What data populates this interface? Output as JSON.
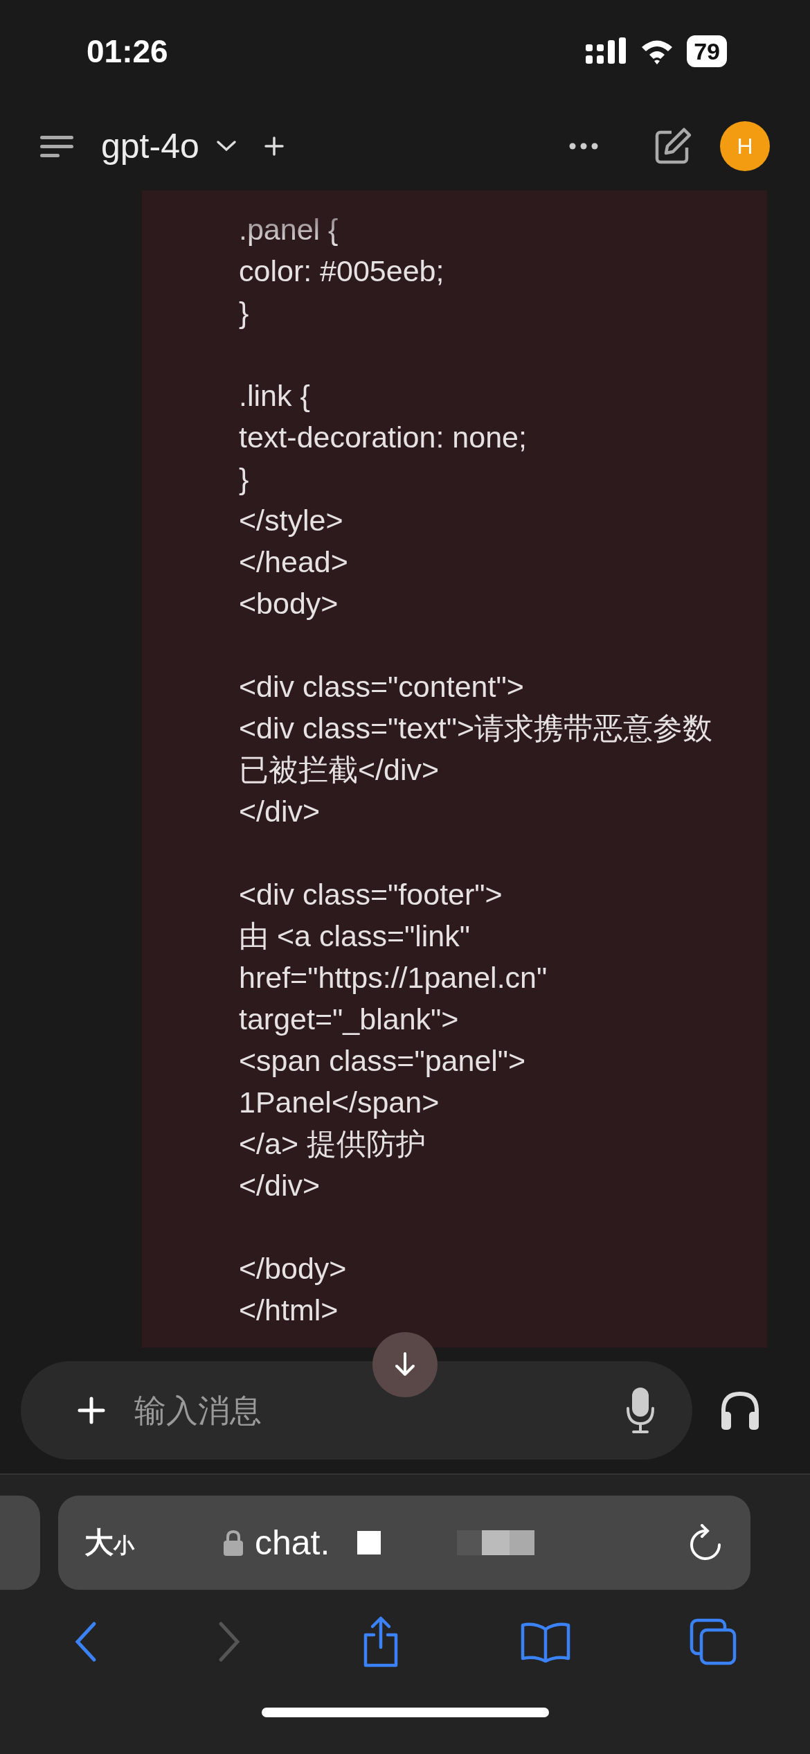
{
  "status_bar": {
    "time": "01:26",
    "battery": "79"
  },
  "header": {
    "model": "gpt-4o",
    "avatar": "H"
  },
  "code_paragraphs": [
    [
      ".panel {",
      "color: #005eeb;",
      "}"
    ],
    [
      ".link {",
      "text-decoration: none;",
      "}",
      "</style>",
      "</head>",
      "<body>"
    ],
    [
      "<div class=\"content\">",
      "<div class=\"text\">请求携带恶意参数",
      "已被拦截</div>",
      "</div>"
    ],
    [
      "<div class=\"footer\">",
      "由 <a class=\"link\"",
      "href=\"https://1panel.cn\"",
      "target=\"_blank\">",
      "<span class=\"panel\">",
      "1Panel</span>",
      "</a> 提供防护",
      "</div>"
    ],
    [
      "</body>",
      "</html>"
    ]
  ],
  "composer": {
    "placeholder": "输入消息"
  },
  "browser": {
    "text_size_big": "大",
    "text_size_small": "小",
    "url": "chat."
  }
}
